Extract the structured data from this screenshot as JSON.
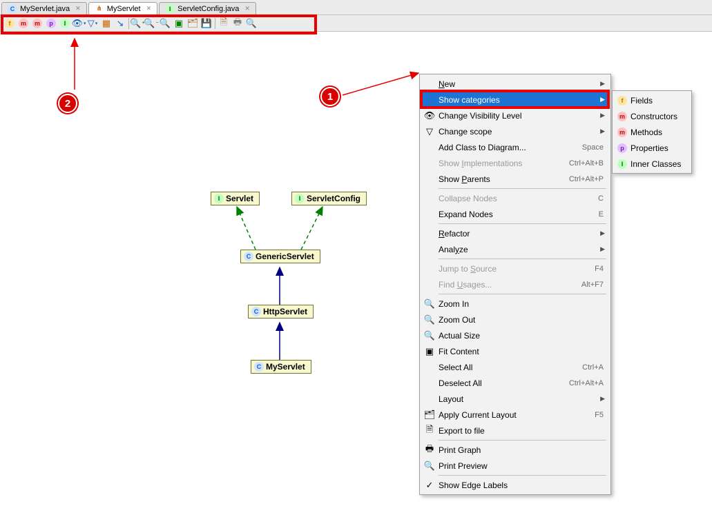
{
  "tabs": [
    {
      "label": "MyServlet.java",
      "icon": "C",
      "iconColor": "#1060c0",
      "iconBg": "#cfe2ff"
    },
    {
      "label": "MyServlet",
      "icon": "⋔",
      "iconColor": "#cc6600",
      "iconBg": "#fff"
    },
    {
      "label": "ServletConfig.java",
      "icon": "I",
      "iconColor": "#006000",
      "iconBg": "#c0ffc0"
    }
  ],
  "activeTab": 1,
  "toolbar_icons": [
    {
      "name": "fields-icon",
      "glyph": "f",
      "color": "#b87400",
      "bg": "#ffe5a0"
    },
    {
      "name": "constructors-icon",
      "glyph": "m",
      "color": "#b01010",
      "bg": "#ffc0c0"
    },
    {
      "name": "methods-icon",
      "glyph": "m",
      "color": "#b01010",
      "bg": "#ffc0c0"
    },
    {
      "name": "properties-icon",
      "glyph": "p",
      "color": "#6a1eb0",
      "bg": "#e5c0ff"
    },
    {
      "name": "inner-classes-icon",
      "glyph": "I",
      "color": "#006000",
      "bg": "#c0ffc0"
    },
    {
      "name": "visibility-icon",
      "glyph": "👁",
      "color": "#1060c0",
      "sub": "▾"
    },
    {
      "name": "scope-icon",
      "glyph": "▽",
      "color": "#1060c0",
      "sub": "▾"
    },
    {
      "name": "dependencies-icon",
      "glyph": "▦",
      "color": "#cc6600"
    },
    {
      "name": "edge-labels-icon",
      "glyph": "↘",
      "color": "#1060c0"
    },
    {
      "sep": true
    },
    {
      "name": "zoom-in-icon",
      "glyph": "🔍",
      "sub": "+"
    },
    {
      "name": "zoom-out-icon",
      "glyph": "🔍",
      "sub": "−"
    },
    {
      "name": "actual-size-icon",
      "glyph": "🔍"
    },
    {
      "name": "fit-content-icon",
      "glyph": "▣",
      "color": "#008000"
    },
    {
      "name": "apply-layout-icon",
      "glyph": "🗂",
      "color": "#a07030"
    },
    {
      "name": "save-icon",
      "glyph": "💾",
      "color": "#3060c0"
    },
    {
      "sep": true
    },
    {
      "name": "export-icon",
      "glyph": "🗎",
      "color": "#a07030"
    },
    {
      "name": "print-icon",
      "glyph": "🖶",
      "color": "#808080"
    },
    {
      "name": "print-preview-icon",
      "glyph": "🔍"
    }
  ],
  "uml": {
    "servlet_icon": "I",
    "servlet": "Servlet",
    "servletconfig_icon": "I",
    "servletconfig": "ServletConfig",
    "generic_icon": "C",
    "generic": "GenericServlet",
    "http_icon": "C",
    "http": "HttpServlet",
    "my_icon": "C",
    "my": "MyServlet"
  },
  "markers": {
    "m1": "1",
    "m2": "2"
  },
  "ctx": [
    {
      "label": "New",
      "sub": true,
      "u": 0
    },
    {
      "label": "Show categories",
      "sub": true,
      "sel": true
    },
    {
      "label": "Change Visibility Level",
      "icon": "👁",
      "sub": true
    },
    {
      "label": "Change scope",
      "icon": "▽",
      "sub": true
    },
    {
      "label": "Add Class to Diagram...",
      "sc": "Space"
    },
    {
      "label": "Show Implementations",
      "sc": "Ctrl+Alt+B",
      "disabled": true,
      "u": 5
    },
    {
      "label": "Show Parents",
      "sc": "Ctrl+Alt+P",
      "u": 5
    },
    {
      "sep": true
    },
    {
      "label": "Collapse Nodes",
      "sc": "C",
      "disabled": true
    },
    {
      "label": "Expand Nodes",
      "sc": "E"
    },
    {
      "sep": true
    },
    {
      "label": "Refactor",
      "sub": true,
      "u": 0
    },
    {
      "label": "Analyze",
      "sub": true,
      "u": 4
    },
    {
      "sep": true
    },
    {
      "label": "Jump to Source",
      "sc": "F4",
      "disabled": true,
      "u": 8
    },
    {
      "label": "Find Usages...",
      "sc": "Alt+F7",
      "disabled": true,
      "u": 5
    },
    {
      "sep": true
    },
    {
      "label": "Zoom In",
      "icon": "🔍"
    },
    {
      "label": "Zoom Out",
      "icon": "🔍"
    },
    {
      "label": "Actual Size",
      "icon": "🔍"
    },
    {
      "label": "Fit Content",
      "icon": "▣"
    },
    {
      "label": "Select All",
      "sc": "Ctrl+A"
    },
    {
      "label": "Deselect All",
      "sc": "Ctrl+Alt+A"
    },
    {
      "label": "Layout",
      "sub": true
    },
    {
      "label": "Apply Current Layout",
      "icon": "🗂",
      "sc": "F5"
    },
    {
      "label": "Export to file",
      "icon": "🗎"
    },
    {
      "sep": true
    },
    {
      "label": "Print Graph",
      "icon": "🖶"
    },
    {
      "label": "Print Preview",
      "icon": "🔍"
    },
    {
      "sep": true
    },
    {
      "label": "Show Edge Labels",
      "icon": "✓"
    }
  ],
  "sub_ctx": [
    {
      "label": "Fields",
      "icon": "f",
      "color": "#b87400",
      "bg": "#ffe5a0"
    },
    {
      "label": "Constructors",
      "icon": "m",
      "color": "#b01010",
      "bg": "#ffc0c0"
    },
    {
      "label": "Methods",
      "icon": "m",
      "color": "#b01010",
      "bg": "#ffc0c0"
    },
    {
      "label": "Properties",
      "icon": "p",
      "color": "#6a1eb0",
      "bg": "#e5c0ff"
    },
    {
      "label": "Inner Classes",
      "icon": "I",
      "color": "#006000",
      "bg": "#c0ffc0"
    }
  ]
}
